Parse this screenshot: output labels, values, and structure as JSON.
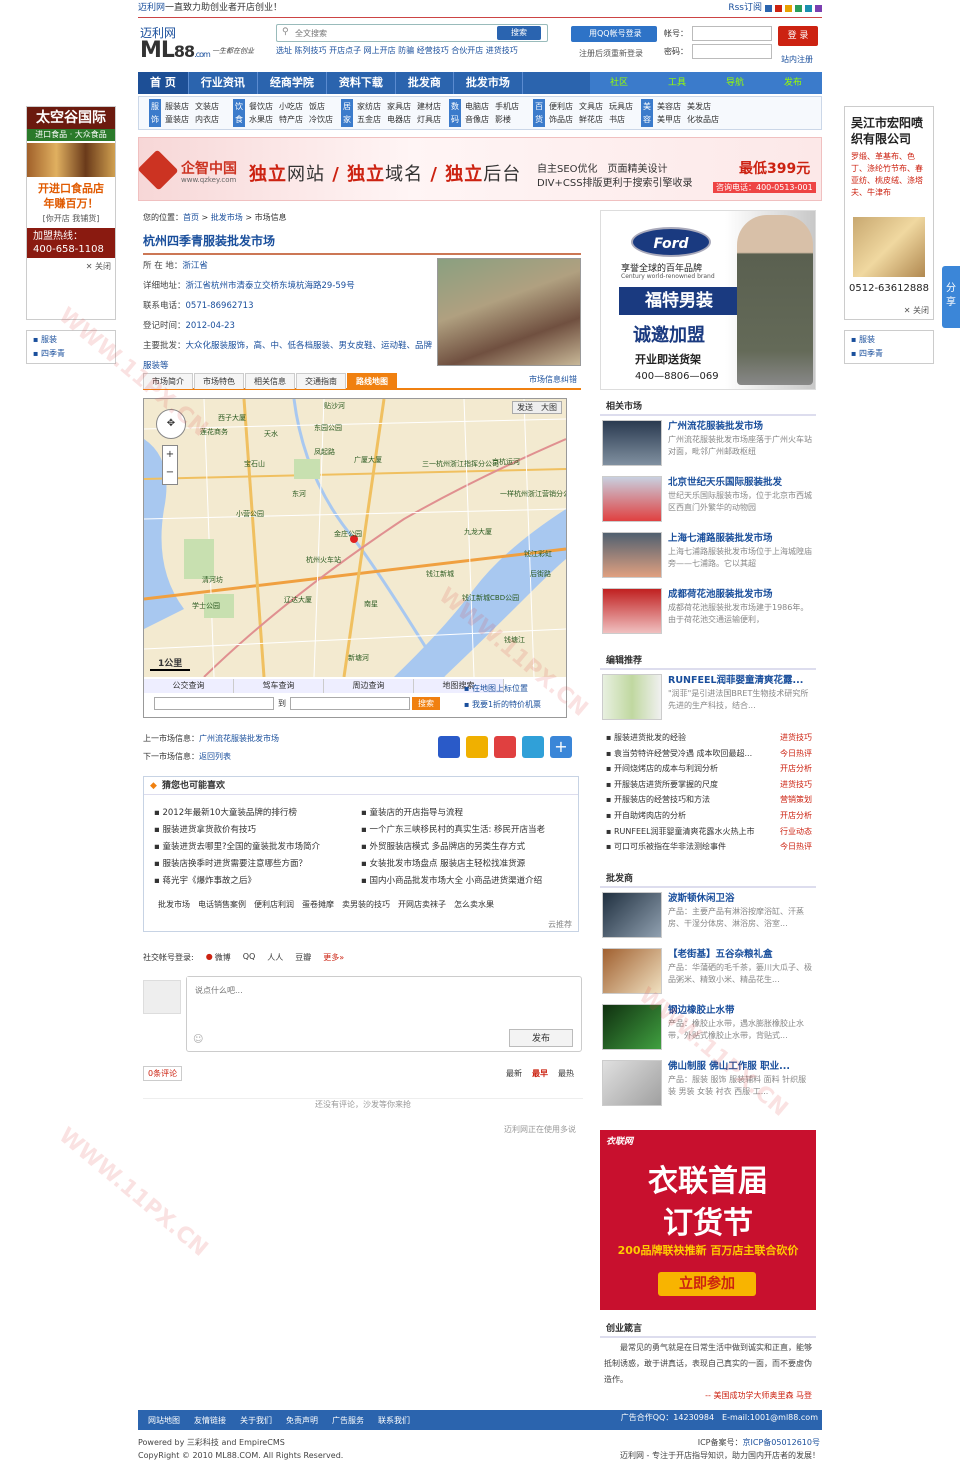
{
  "topbar": {
    "site": "迈利网",
    "slogan": "一直致力助创业者开店创业！",
    "rss": "Rss订阅",
    "colors": [
      "#2b64ae",
      "#c21",
      "#e8a000",
      "#2a9d5a",
      "#1a8fb0",
      "#7b3fb0"
    ]
  },
  "logo": {
    "cn": "迈利网",
    "en": "ML",
    "num": "88",
    "com": ".com",
    "tag": "一生都在创业"
  },
  "search": {
    "placeholder": "全文搜索",
    "btn": "搜索",
    "hot": "选址 陈列技巧 开店点子 网上开店 防骗 经营技巧 合伙开店 进货技巧"
  },
  "qq": {
    "btn": "用QQ帐号登录",
    "tip": "注册后须重新登录"
  },
  "login": {
    "user": "帐号：",
    "pass": "密码：",
    "btn": "登 录",
    "reg": "站内注册"
  },
  "nav": {
    "items": [
      "首 页",
      "行业资讯",
      "经商学院",
      "资料下载",
      "批发商",
      "批发市场"
    ],
    "right": [
      "社区",
      "工具",
      "导航",
      "发布"
    ]
  },
  "cats": [
    {
      "label": "服饰",
      "items": [
        "服装店",
        "文装店",
        "",
        "童装店",
        "内衣店",
        ""
      ]
    },
    {
      "label": "饮食",
      "items": [
        "餐饮店",
        "小吃店",
        "饭店",
        "水果店",
        "特产店",
        "冷饮店"
      ]
    },
    {
      "label": "居家",
      "items": [
        "家纺店",
        "家具店",
        "建材店",
        "五金店",
        "电器店",
        "灯具店"
      ]
    },
    {
      "label": "数码",
      "items": [
        "电脑店",
        "手机店",
        "",
        "音像店",
        "影楼",
        ""
      ]
    },
    {
      "label": "百货",
      "items": [
        "便利店",
        "文具店",
        "玩具店",
        "饰品店",
        "鲜花店",
        "书店"
      ]
    },
    {
      "label": "美容",
      "items": [
        "美容店",
        "美发店",
        "",
        "美甲店",
        "化妆品店",
        ""
      ]
    }
  ],
  "banner": {
    "brand": "企智中国",
    "url": "www.qzkey.com",
    "m1": "独立",
    "m1b": "网站",
    "m2": "独立",
    "m2b": "域名",
    "m3": "独立",
    "m3b": "后台",
    "s1": "自主SEO优化　页面精美设计",
    "s2": "DIV+CSS排版更利于搜索引擎收录",
    "price": "最低399元",
    "tel": "咨询电话：400-0513-001"
  },
  "crumb": {
    "pre": "您的位置：",
    "home": "首页",
    "c1": "批发市场",
    "c2": "市场信息",
    "sep": " > "
  },
  "market": {
    "title": "杭州四季青服装批发市场",
    "info": [
      {
        "k": "所 在 地：",
        "v": "浙江省"
      },
      {
        "k": "详细地址：",
        "v": "浙江省杭州市清泰立交桥东境杭海路29-59号"
      },
      {
        "k": "联系电话：",
        "v": "0571-86962713"
      },
      {
        "k": "登记时间：",
        "v": "2012-04-23"
      },
      {
        "k": "主要批发：",
        "v": "大众化服装服饰，高、中、低各档服装、男女皮鞋、运动鞋、品牌服装等"
      }
    ],
    "tabs": [
      "市场简介",
      "市场特色",
      "相关信息",
      "交通指南",
      "路线地图"
    ],
    "correct": "市场信息纠错"
  },
  "map": {
    "send": "发送",
    "big": "大图",
    "scale": "1公里",
    "tabs": [
      "公交查询",
      "驾车查询",
      "周边查询",
      "地图搜索"
    ],
    "to": "到",
    "search": "搜索",
    "links": [
      "在地图上标位置",
      "我要1折的特价机票"
    ],
    "places": [
      "西子大厦",
      "莲花商务",
      "东园公园",
      "天水",
      "凤起路",
      "广厦大厦",
      "三一杭州浙江指挥分公司",
      "京杭运河",
      "一样杭州浙江营销分公司",
      "东河",
      "小营公园",
      "杭州火车站",
      "钱江新城",
      "钱江新城CBD公园",
      "清河坊",
      "辽达大厦",
      "学士公园",
      "南星",
      "新塘河",
      "后街路",
      "钱塘江",
      "宝石山",
      "九龙大厦",
      "贴沙河",
      "金庄公园",
      "钱江彩虹"
    ]
  },
  "prevnext": {
    "prev": "上一市场信息：",
    "prevv": "广州流花服装批发市场",
    "next": "下一市场信息：",
    "nextv": "返回列表"
  },
  "guess": {
    "title": "猜您也可能喜欢",
    "left": [
      "2012年最新10大童装品牌的排行榜",
      "服装进货拿货款价有技巧",
      "童装进货去哪里?全国的童装批发市场简介",
      "服装店换季时进货需要注意哪些方面？",
      "蒋光宇《爆炸事故之后》"
    ],
    "right": [
      "童装店的开店指导与流程",
      "一个广东三峡移民村的真实生活: 移民开店当老",
      "外贸服装店模式 多品牌店的另类生存方式",
      "女装批发市场盘点 服装店主轻松找准货源",
      "国内小商品批发市场大全 小商品进货渠道介绍"
    ],
    "kw": [
      "批发市场",
      "电话销售案例",
      "便利店利润",
      "蛋卷摊摩",
      "卖男装的技巧",
      "开网店卖袜子",
      "怎么卖水果"
    ],
    "foot": "云推荐"
  },
  "social": {
    "label": "社交帐号登录:",
    "items": [
      "微博",
      "QQ",
      "人人",
      "豆瓣",
      "更多»"
    ]
  },
  "comment": {
    "placeholder": "说点什么吧...",
    "publish": "发布",
    "count": "0条评论",
    "sort": [
      "最新",
      "最早",
      "最热"
    ],
    "empty": "还没有评论，沙发等你来抢",
    "footer": "迈利网正在使用多说"
  },
  "ford": {
    "logo": "Ford",
    "l1": "享誉全球的百年品牌",
    "l2": "Century world-renowned brand",
    "big": "福特男装",
    "big2": "诚邀加盟",
    "l3": "开业即送货架",
    "tel": "400—8806—069"
  },
  "related": {
    "title": "相关市场",
    "items": [
      {
        "t": "广州流花服装批发市场",
        "d": "广州流花服装批发市场座落于广州火车站对面，毗邻广州邮政枢纽"
      },
      {
        "t": "北京世纪天乐国际服装批发",
        "d": "世纪天乐国际服装市场，位于北京市西城区西直门外繁华的动物园"
      },
      {
        "t": "上海七浦路服装批发市场",
        "d": "上海七浦路服装批发市场位于上海城隍庙旁——七浦路。它以其超"
      },
      {
        "t": "成都荷花池服装批发市场",
        "d": "成都荷花池服装批发市场建于1986年。由于荷花池交通运输便利，"
      }
    ]
  },
  "editor": {
    "title": "编辑推荐",
    "top": {
      "t": "RUNFEEL润菲婴童清爽花露...",
      "d": "\"润菲\"是引进法国BRET生物技术研究所先进的生产科技，结合..."
    },
    "list": [
      {
        "t": "服装进货批发的经验",
        "c": "进货技巧"
      },
      {
        "t": "袁当劳特许经营受冷遇 成本吹回最超...",
        "c": "今日热评"
      },
      {
        "t": "开间烧烤店的成本与利润分析",
        "c": "开店分析"
      },
      {
        "t": "开服装店进货所要掌握的尺度",
        "c": "进货技巧"
      },
      {
        "t": "开服装店的经营技巧和方法",
        "c": "营销策划"
      },
      {
        "t": "开自助烤肉店的分析",
        "c": "开店分析"
      },
      {
        "t": "RUNFEEL润菲婴童清爽花露水火热上市",
        "c": "行业动态"
      },
      {
        "t": "可口可乐被指在华非法测绘事件",
        "c": "今日热评"
      }
    ]
  },
  "wholesalers": {
    "title": "批发商",
    "items": [
      {
        "t": "波斯顿休闲卫浴",
        "d": "产品：主要产品有淋浴按摩浴缸、汗蒸房、干湿分体房、淋浴房、浴室..."
      },
      {
        "t": "【老街基】五谷杂粮礼盒",
        "d": "产品：华蒲硒的毛千茶，篓川大瓜子、极品粥米、精致小米、精品花生..."
      },
      {
        "t": "钢边橡胶止水带",
        "d": "产品：橡胶止水带，遇水膨胀橡胶止水带，外贴式橡胶止水带，背贴式..."
      },
      {
        "t": "佛山制服 佛山工作服 职业...",
        "d": "产品：服装 服饰 服装辅料 面料 针织服装 男装 女装 衬衣 西服 工..."
      }
    ]
  },
  "yilian": {
    "brand": "衣联网",
    "l1": "衣联首届",
    "l2": "订货节",
    "l3": "200品牌联袂推新 百万店主联合砍价",
    "btn": "立即参加"
  },
  "motto": {
    "title": "创业箴言",
    "text": "最常见的勇气就是在日常生活中做到诚实和正直，能够抵制诱惑，敢于讲真话，表现自己真实的一面，而不要虚伪造作。",
    "author": "-- 美国成功学大师奥里森 马登"
  },
  "footer": {
    "links": [
      "网站地图",
      "友情链接",
      "关于我们",
      "免责声明",
      "广告服务",
      "联系我们"
    ],
    "ad": "广告合作QQ：14230984　E-mail:1001@ml88.com"
  },
  "copyright": {
    "l1": "Powered by 三彩科技 and EmpireCMS",
    "l2": "CopyRight © 2010 ML88.COM. All Rights Reserved.",
    "r1a": "ICP备案号：",
    "r1b": "京ICP备05012610号",
    "r2": "迈利网 - 专注于开店指导知识，助力国内开店者的发展！"
  },
  "leftad": {
    "title": "太空谷国际",
    "sub": "进口食品 · 大众食品",
    "slogan": "开进口食品店 年赚百万！",
    "tags": "[你开店 我铺货]",
    "hot": "加盟热线：",
    "tel": "400-658-1108",
    "close": "关闭",
    "links": [
      "服装",
      "四季青"
    ]
  },
  "rightad": {
    "title": "吴江市宏阳喷织有限公司",
    "items": "罗缎、革基布、色丁、涤纶竹节布、春亚纺、桃皮绒、涤塔夫、牛津布",
    "tel": "0512-63612888",
    "close": "关闭",
    "links": [
      "服装",
      "四季青"
    ]
  },
  "sharebar": "分享"
}
